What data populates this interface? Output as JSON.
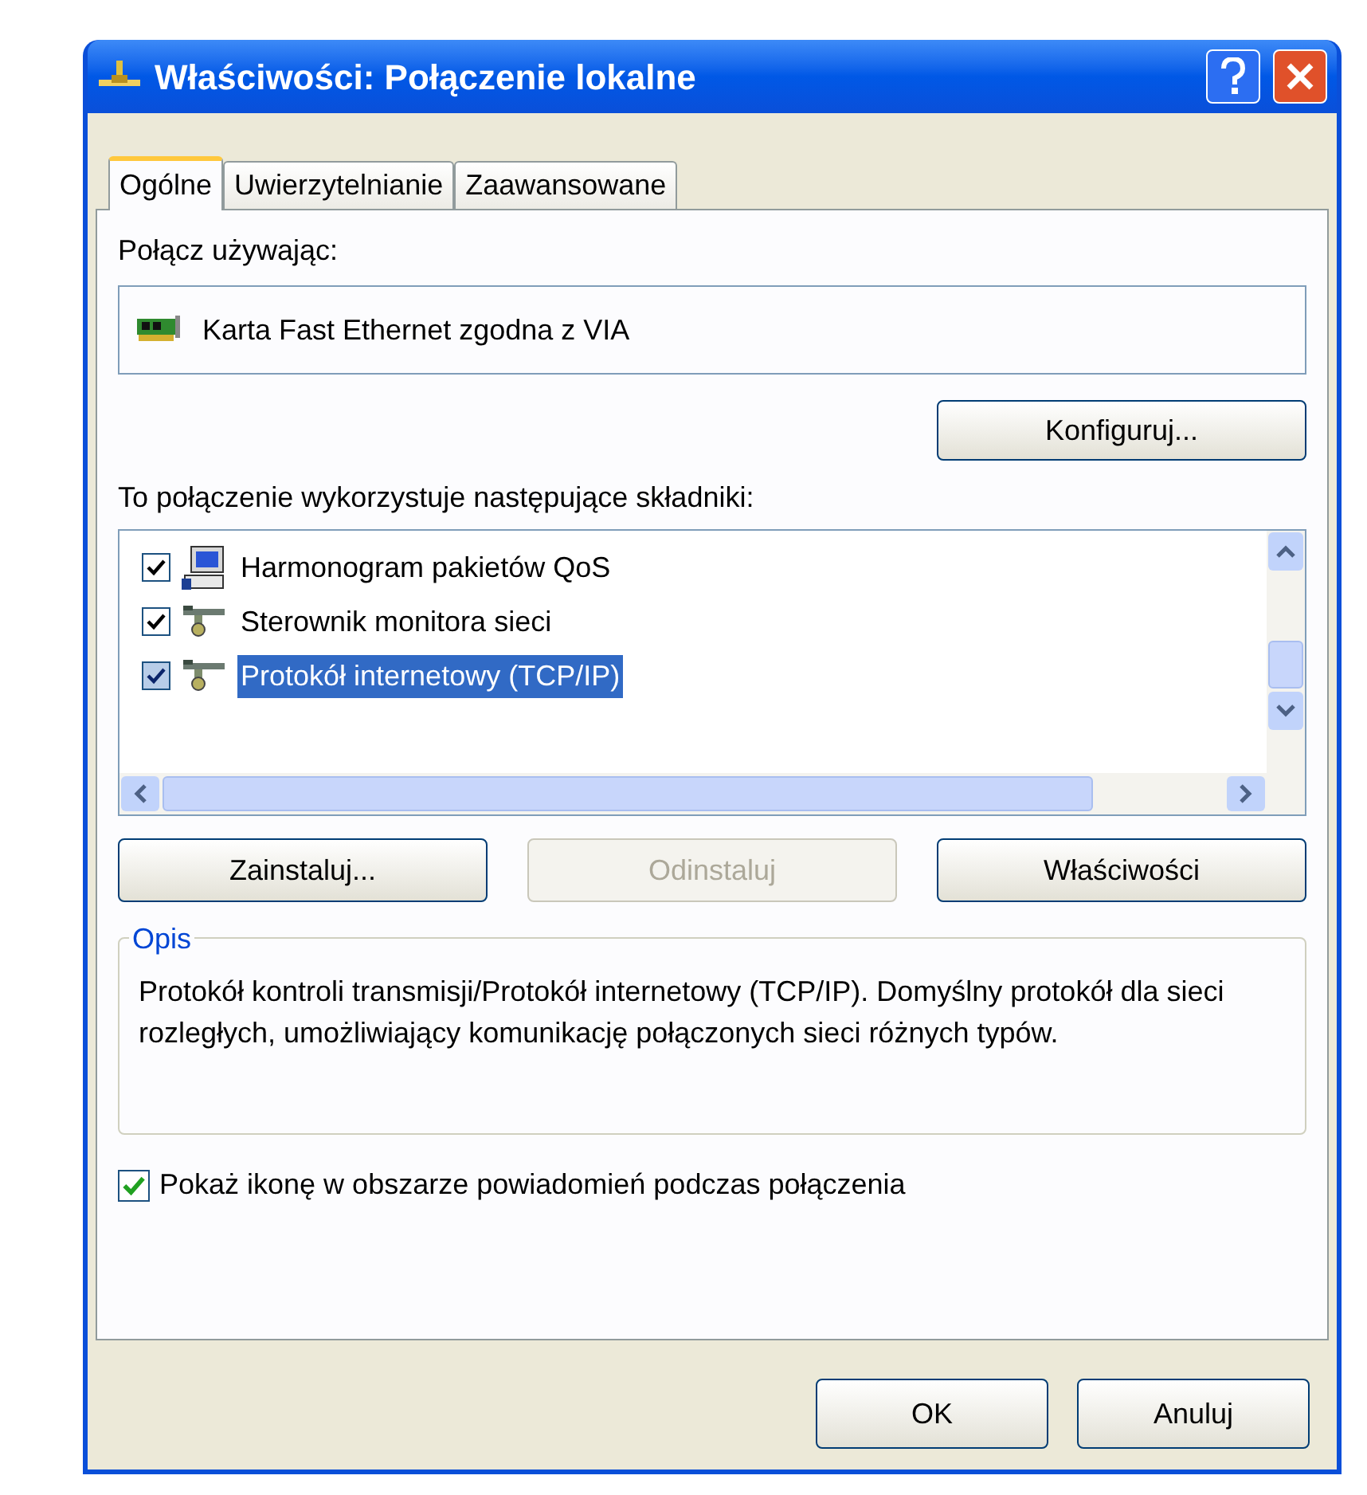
{
  "window": {
    "title": "Właściwości: Połączenie lokalne"
  },
  "tabs": [
    {
      "label": "Ogólne",
      "selected": true
    },
    {
      "label": "Uwierzytelnianie",
      "selected": false
    },
    {
      "label": "Zaawansowane",
      "selected": false
    }
  ],
  "connect_using": {
    "label": "Połącz używając:",
    "adapter": "Karta Fast Ethernet zgodna z VIA",
    "button": "Konfiguruj..."
  },
  "components": {
    "label": "To połączenie wykorzystuje następujące składniki:",
    "items": [
      {
        "name": "Harmonogram pakietów QoS",
        "checked": true,
        "selected": false,
        "kind": "computer"
      },
      {
        "name": "Sterownik monitora sieci",
        "checked": true,
        "selected": false,
        "kind": "network"
      },
      {
        "name": "Protokół internetowy (TCP/IP)",
        "checked": true,
        "selected": true,
        "kind": "network"
      }
    ]
  },
  "component_buttons": [
    {
      "label": "Zainstaluj...",
      "disabled": false
    },
    {
      "label": "Odinstaluj",
      "disabled": true
    },
    {
      "label": "Właściwości",
      "disabled": false
    }
  ],
  "description": {
    "title": "Opis",
    "text": "Protokół kontroli transmisji/Protokół internetowy (TCP/IP). Domyślny protokół dla sieci rozległych, umożliwiający komunikację połączonych sieci różnych typów."
  },
  "show_icon": {
    "label": "Pokaż ikonę w obszarze powiadomień podczas połączenia",
    "checked": true
  },
  "dialog_buttons": [
    "OK",
    "Anuluj"
  ]
}
